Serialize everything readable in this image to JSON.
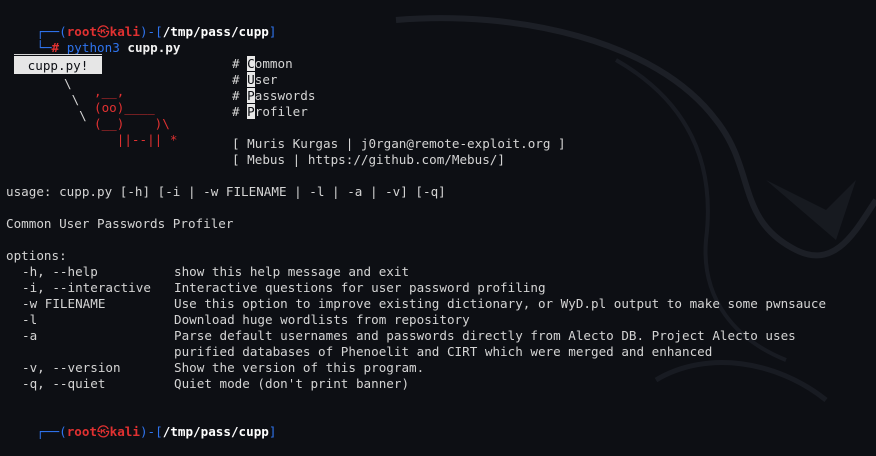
{
  "prompt": {
    "bracket_open": "┌──(",
    "user": "root",
    "skull": "㉿",
    "host": "kali",
    "bracket_mid": ")-[",
    "path": "/tmp/pass/cupp",
    "bracket_close": "]",
    "second_prefix": "└─",
    "hash": "#",
    "command_program": "python3",
    "command_arg": "cupp.py"
  },
  "banner": {
    "label": "cupp.py!",
    "mascot_lines": [
      "\\",
      " \\",
      "  \\"
    ],
    "mascot_face_lines": [
      ",__,",
      "(oo)____",
      "(__)    )\\",
      "   ||--|| *"
    ],
    "acronym_lines": [
      {
        "prefix": "# ",
        "first": "C",
        "rest": "ommon"
      },
      {
        "prefix": "# ",
        "first": "U",
        "rest": "ser"
      },
      {
        "prefix": "# ",
        "first": "P",
        "rest": "asswords"
      },
      {
        "prefix": "# ",
        "first": "P",
        "rest": "rofiler"
      }
    ],
    "credits": [
      "[ Muris Kurgas | j0rgan@remote-exploit.org ]",
      "[ Mebus | https://github.com/Mebus/]"
    ]
  },
  "usage": "usage: cupp.py [-h] [-i | -w FILENAME | -l | -a | -v] [-q]",
  "description": "Common User Passwords Profiler",
  "options_header": "options:",
  "options": [
    {
      "key": "-h, --help",
      "desc": "show this help message and exit"
    },
    {
      "key": "-i, --interactive",
      "desc": "Interactive questions for user password profiling"
    },
    {
      "key": "-w FILENAME",
      "desc": "Use this option to improve existing dictionary, or WyD.pl output to make some pwnsauce"
    },
    {
      "key": "-l",
      "desc": "Download huge wordlists from repository"
    },
    {
      "key": "-a",
      "desc": "Parse default usernames and passwords directly from Alecto DB. Project Alecto uses"
    },
    {
      "key": "",
      "desc": "purified databases of Phenoelit and CIRT which were merged and enhanced"
    },
    {
      "key": "-v, --version",
      "desc": "Show the version of this program."
    },
    {
      "key": "-q, --quiet",
      "desc": "Quiet mode (don't print banner)"
    }
  ],
  "colors": {
    "background": "#0d0f14",
    "prompt_blue": "#2f74ee",
    "prompt_red": "#e03131",
    "text": "#d4d4d4"
  }
}
